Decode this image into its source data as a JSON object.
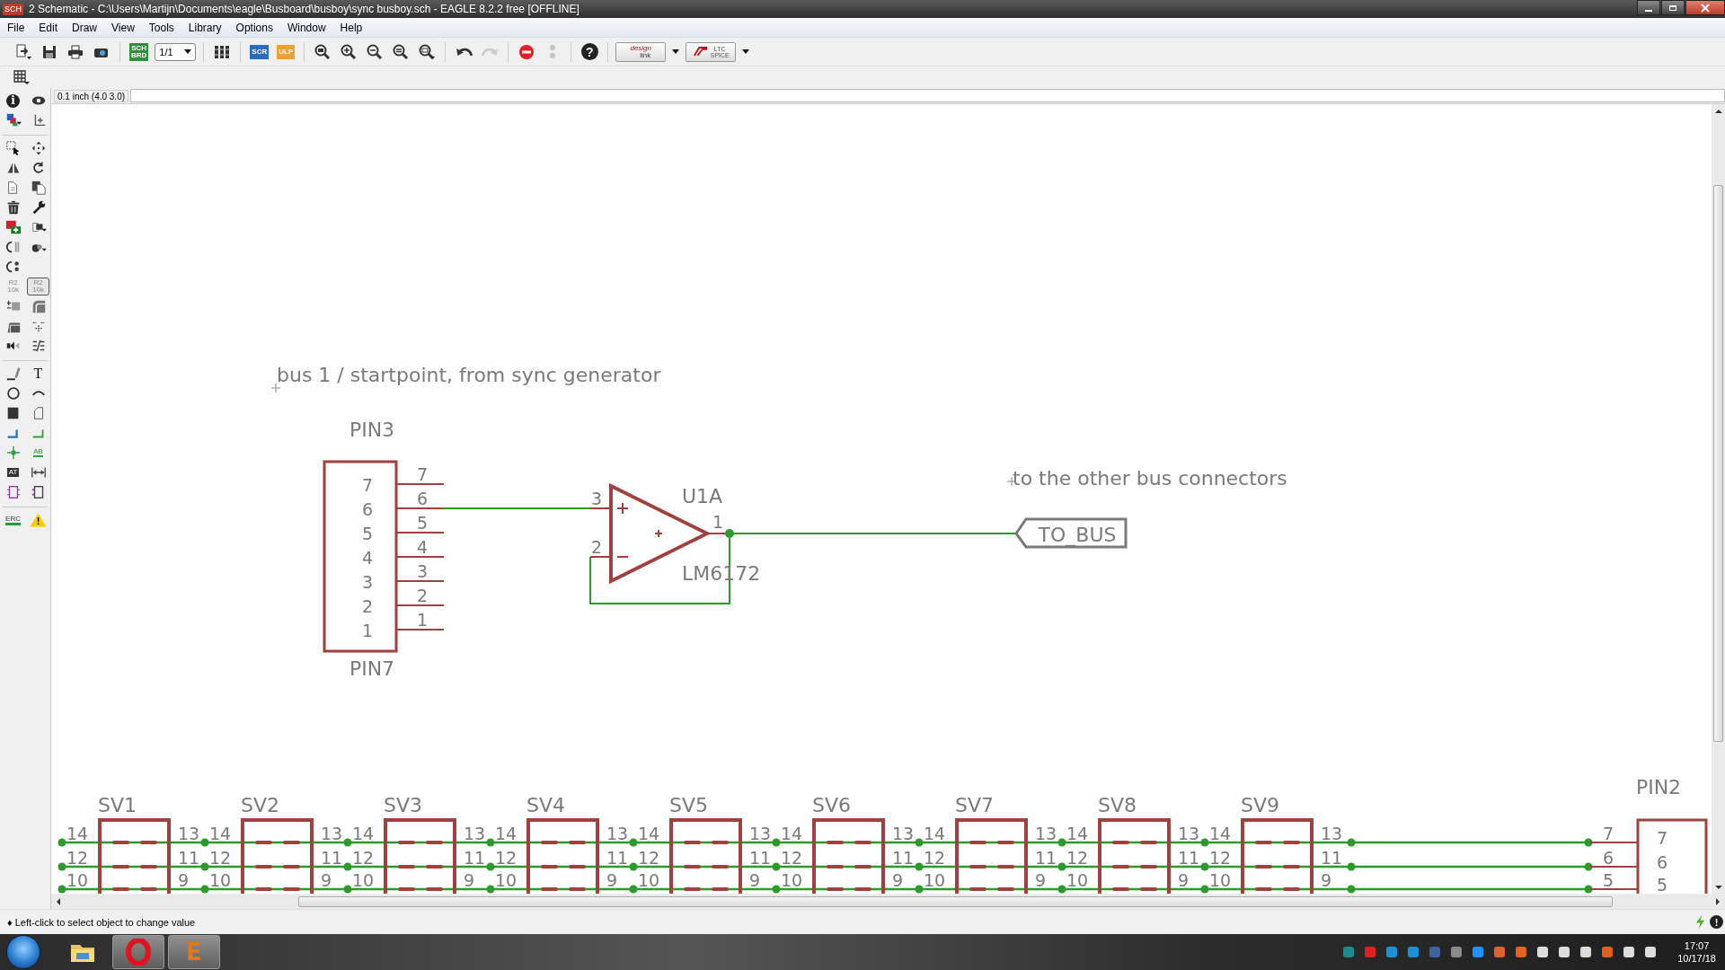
{
  "window": {
    "app_icon": "SCH",
    "title": "2 Schematic - C:\\Users\\Martijn\\Documents\\eagle\\Busboard\\busboy\\sync busboy.sch - EAGLE 8.2.2 free [OFFLINE]"
  },
  "menu": [
    "File",
    "Edit",
    "Draw",
    "View",
    "Tools",
    "Library",
    "Options",
    "Window",
    "Help"
  ],
  "toolbar": [
    [
      {
        "kind": "open",
        "disabled": false
      },
      {
        "kind": "save",
        "disabled": false
      },
      {
        "kind": "print",
        "disabled": false
      },
      {
        "kind": "cam",
        "disabled": false
      }
    ],
    [
      {
        "kind": "sch-brd",
        "text": [
          "SCH",
          "BRD"
        ],
        "disabled": false
      },
      {
        "kind": "combo",
        "value": "1/1",
        "disabled": false
      }
    ],
    [
      {
        "kind": "library",
        "disabled": false
      }
    ],
    [
      {
        "kind": "script",
        "text": [
          "SCR"
        ],
        "disabled": false
      },
      {
        "kind": "ulp",
        "text": [
          "ULP"
        ],
        "disabled": false
      }
    ],
    [
      {
        "kind": "zoom-fit",
        "disabled": false
      },
      {
        "kind": "zoom-in",
        "disabled": false
      },
      {
        "kind": "zoom-out",
        "disabled": false
      },
      {
        "kind": "zoom-last",
        "disabled": false
      },
      {
        "kind": "zoom-area",
        "disabled": false
      }
    ],
    [
      {
        "kind": "undo",
        "disabled": false
      },
      {
        "kind": "redo",
        "disabled": true
      }
    ],
    [
      {
        "kind": "stop",
        "disabled": false
      },
      {
        "kind": "go",
        "disabled": true
      }
    ],
    [
      {
        "kind": "help",
        "text": [
          "?"
        ],
        "disabled": false
      }
    ],
    [
      {
        "kind": "design-link",
        "text": [
          "design",
          "link"
        ],
        "disabled": false
      },
      {
        "kind": "ltc-spice",
        "text": [
          "LTC",
          "SPICE"
        ],
        "disabled": false
      }
    ]
  ],
  "coordinates": "0.1 inch (4.0 3.0)",
  "left_toolbar": [
    [
      [
        {
          "kind": "info",
          "text": [
            "i"
          ],
          "selected": false
        },
        {
          "kind": "show",
          "selected": false
        }
      ],
      [
        {
          "kind": "layers",
          "selected": false
        },
        {
          "kind": "mark",
          "selected": false
        }
      ]
    ],
    [
      [
        {
          "kind": "group",
          "selected": false
        },
        {
          "kind": "move",
          "selected": false
        }
      ],
      [
        {
          "kind": "mirror",
          "selected": false
        },
        {
          "kind": "rotate",
          "selected": false
        }
      ],
      [
        {
          "kind": "copy",
          "selected": false
        },
        {
          "kind": "paste",
          "selected": false
        }
      ],
      [
        {
          "kind": "delete",
          "selected": false
        },
        {
          "kind": "wrench",
          "selected": false
        }
      ],
      [
        {
          "kind": "add",
          "selected": false
        },
        {
          "kind": "replace",
          "selected": false
        }
      ],
      [
        {
          "kind": "gateswap",
          "selected": false
        },
        {
          "kind": "invoke",
          "selected": false
        }
      ],
      [
        {
          "kind": "pinswap",
          "selected": false
        }
      ],
      [
        {
          "kind": "name",
          "text": [
            "R2",
            "10k"
          ],
          "selected": false
        },
        {
          "kind": "value",
          "text": [
            "R2",
            "10k"
          ],
          "selected": true
        }
      ],
      [
        {
          "kind": "smash",
          "selected": false
        },
        {
          "kind": "miter",
          "selected": false
        }
      ],
      [
        {
          "kind": "slice",
          "selected": false
        },
        {
          "kind": "split",
          "selected": false
        }
      ],
      [
        {
          "kind": "optimize",
          "selected": false
        },
        {
          "kind": "ripup",
          "selected": false
        }
      ]
    ],
    [
      [
        {
          "kind": "line",
          "selected": false
        },
        {
          "kind": "text",
          "text": [
            "T"
          ],
          "selected": false
        }
      ],
      [
        {
          "kind": "circle",
          "selected": false
        },
        {
          "kind": "arc",
          "selected": false
        }
      ],
      [
        {
          "kind": "rect",
          "selected": false
        },
        {
          "kind": "polygon",
          "selected": false
        }
      ],
      [
        {
          "kind": "bus",
          "selected": false
        },
        {
          "kind": "net",
          "selected": false
        }
      ],
      [
        {
          "kind": "junction",
          "selected": false
        },
        {
          "kind": "label",
          "text": [
            "AB"
          ],
          "selected": false
        }
      ],
      [
        {
          "kind": "attribute",
          "text": [
            "AT"
          ],
          "selected": false
        },
        {
          "kind": "dimension",
          "selected": false
        }
      ],
      [
        {
          "kind": "module",
          "selected": false
        },
        {
          "kind": "port",
          "selected": false
        }
      ]
    ],
    [
      [
        {
          "kind": "erc",
          "text": [
            "ERC"
          ],
          "selected": false
        },
        {
          "kind": "warning",
          "text": [
            "!"
          ],
          "selected": false
        }
      ]
    ]
  ],
  "schematic": {
    "notes": [
      "bus 1 / startpoint, from sync generator",
      "to the other bus connectors"
    ],
    "input_connector": {
      "name": "PIN3",
      "value": "PIN7",
      "pins": [
        {
          "pad": "7",
          "label": "7"
        },
        {
          "pad": "6",
          "label": "6"
        },
        {
          "pad": "5",
          "label": "5"
        },
        {
          "pad": "4",
          "label": "4"
        },
        {
          "pad": "3",
          "label": "3"
        },
        {
          "pad": "2",
          "label": "2"
        },
        {
          "pad": "1",
          "label": "1"
        }
      ]
    },
    "opamp": {
      "name": "U1A",
      "value": "LM6172",
      "pins": [
        "3",
        "2",
        "1"
      ]
    },
    "net_label": "TO_BUS",
    "headers": [
      {
        "name": "SV1",
        "left_pins": [
          "14",
          "12",
          "10"
        ],
        "right_pins": [
          "13",
          "11",
          "9"
        ]
      },
      {
        "name": "SV2",
        "left_pins": [
          "14",
          "12",
          "10"
        ],
        "right_pins": [
          "13",
          "11",
          "9"
        ]
      },
      {
        "name": "SV3",
        "left_pins": [
          "14",
          "12",
          "10"
        ],
        "right_pins": [
          "13",
          "11",
          "9"
        ]
      },
      {
        "name": "SV4",
        "left_pins": [
          "14",
          "12",
          "10"
        ],
        "right_pins": [
          "13",
          "11",
          "9"
        ]
      },
      {
        "name": "SV5",
        "left_pins": [
          "14",
          "12",
          "10"
        ],
        "right_pins": [
          "13",
          "11",
          "9"
        ]
      },
      {
        "name": "SV6",
        "left_pins": [
          "14",
          "12",
          "10"
        ],
        "right_pins": [
          "13",
          "11",
          "9"
        ]
      },
      {
        "name": "SV7",
        "left_pins": [
          "14",
          "12",
          "10"
        ],
        "right_pins": [
          "13",
          "11",
          "9"
        ]
      },
      {
        "name": "SV8",
        "left_pins": [
          "14",
          "12",
          "10"
        ],
        "right_pins": [
          "13",
          "11",
          "9"
        ]
      },
      {
        "name": "SV9",
        "left_pins": [
          "14",
          "12",
          "10"
        ],
        "right_pins": [
          "13",
          "11",
          "9"
        ]
      }
    ],
    "end_connector": {
      "name": "PIN2",
      "pins": [
        {
          "pad": "7",
          "label": "7"
        },
        {
          "pad": "6",
          "label": "6"
        },
        {
          "pad": "5",
          "label": "5"
        }
      ]
    }
  },
  "status_bar": {
    "message": "♦ Left-click to select object to change value",
    "indicator": "!"
  },
  "taskbar": {
    "apps": [
      {
        "kind": "folder",
        "selected": false
      },
      {
        "kind": "opera",
        "selected": true
      },
      {
        "kind": "eagle",
        "text": "E",
        "selected": true
      }
    ],
    "time": "17:07",
    "date": "10/17/18"
  }
}
